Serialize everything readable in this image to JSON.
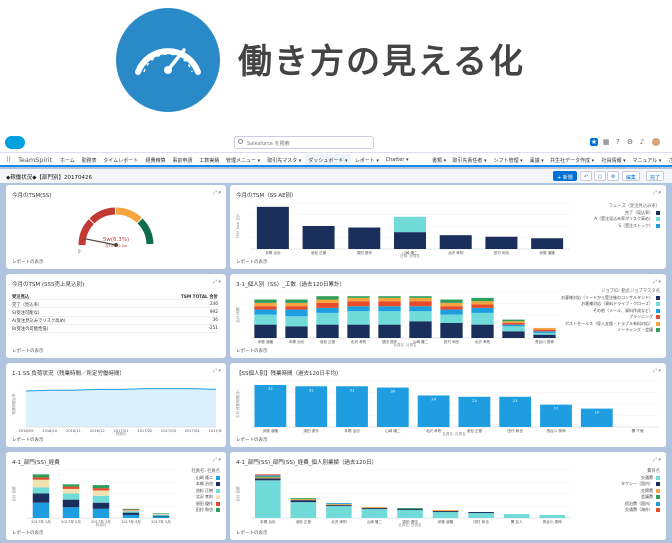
{
  "hero": {
    "title": "働き方の見える化"
  },
  "colors": {
    "navy": "#1b2f5c",
    "teal": "#70dbd9",
    "blue": "#1e9ee0",
    "hero": "#2a8ac7",
    "red": "#c23934",
    "orange": "#f5a43f",
    "green": "#0d6d4b"
  },
  "topbar": {
    "search_placeholder": "Salesforce を検索"
  },
  "nav": {
    "app_name": "TeamSpirit",
    "items": [
      "ホーム",
      "勤務表",
      "タイムレポート",
      "経費精算",
      "事前申請",
      "工数実績",
      "管理メニュー",
      "取引先マスタ",
      "ダッシュボード",
      "レポート",
      "Chatter",
      "書類",
      "取引先責任者",
      "シフト管理",
      "稟議",
      "共生社データ作成",
      "社員情報",
      "マニュアル",
      "さらに表示"
    ],
    "active": "ダッシュボード"
  },
  "dashboard": {
    "title": "◆稼働状況◆【部門別】20170426",
    "buttons": {
      "new": "+ 新規",
      "undo": "↶",
      "refresh": "○",
      "settings": "⚙",
      "edit": "編集",
      "done": "完了"
    }
  },
  "footer_label": "レポートの表示",
  "cards": {
    "c1": {
      "title": "今月のTSM(SS)",
      "value": "5w(6.3%)",
      "sub": "@1w 1-0-2w"
    },
    "c2": {
      "title": "今月のTSM（SS AE別）",
      "ylabel": "TSM Total 合計",
      "xlabel": "社員: 社員名"
    },
    "c3": {
      "title": "今月のTSM (SSS売上見込別)"
    },
    "c4": {
      "title": "3-1_個人別（SS）_工数（過去120日累計）",
      "ylabel": "合計 時間",
      "xlabel": "社員名: 社員名"
    },
    "c5": {
      "title": "1-1 SS 負荷状況（残業時間／所定労働時間）",
      "ylabel": "残業時間比率",
      "xlabel": "勤務月"
    },
    "c6": {
      "title": "【SS個人別】残業時間（過去120日平均）",
      "ylabel": "平均 残業時間(分)",
      "xlabel": "社員名: 社員名"
    },
    "c7": {
      "title": "4-1_部門(SS)_経費",
      "ylabel": "合計 金額",
      "xlabel": "利用月",
      "legend_title": "社員名: 社員名"
    },
    "c8": {
      "title": "4-1_部門(SS)_部門(SS)_経費_個人別業績（過去120日）",
      "ylabel": "合計 金額",
      "xlabel": "社員名: 社員名",
      "legend_title": "費目名"
    }
  },
  "chart_data": [
    {
      "type": "gauge",
      "id": "c1",
      "value": 6.3,
      "range": [
        0,
        100
      ],
      "tick_labels": [
        "0",
        "",
        "",
        "",
        ""
      ],
      "bands": [
        "#c23934",
        "#c23934",
        "#f5a43f",
        "#0d6d4b"
      ]
    },
    {
      "type": "bar",
      "id": "c2",
      "categories": [
        "本郷 治也",
        "池松 正樹",
        "須田 優作",
        "山崎 隆二",
        "北沢 孝則",
        "田村 和也",
        "伊藤 道隆"
      ],
      "series": [
        {
          "name": "完了（見込率）",
          "values": [
            55,
            30,
            28,
            22,
            18,
            16,
            14
          ],
          "color": "#1b2f5c"
        },
        {
          "name": "A（受注見込み率がリスク高め）",
          "values": [
            0,
            0,
            0,
            20,
            0,
            0,
            0
          ],
          "color": "#70dbd9"
        },
        {
          "name": "S（受注ストック）",
          "values": [
            0,
            0,
            0,
            0,
            0,
            0,
            0
          ],
          "color": "#1e9ee0"
        }
      ],
      "ylim": [
        0,
        60
      ],
      "legend_title": "フェーズ（受注見込み率）",
      "legend_position": "right"
    },
    {
      "type": "table",
      "id": "c3",
      "headers": [
        "受注見込",
        "TSM TOTAL 合計"
      ],
      "rows": [
        [
          "完了（見込率）",
          "246"
        ],
        [
          "S(受注可能な)",
          "992"
        ],
        [
          "A(受注見込みでリスク高め)",
          "36"
        ],
        [
          "B(受注の可能性低)",
          "-251"
        ]
      ]
    },
    {
      "type": "bar",
      "id": "c4",
      "stacked": true,
      "categories": [
        "伊藤 道隆",
        "本郷 治也",
        "池松 正樹",
        "北沢 孝則",
        "須田 優作",
        "山崎 隆二",
        "田村 和也",
        "北沢 孝則",
        "",
        "長谷川 泰伸"
      ],
      "series": [
        {
          "name": "お客様対応（リードから受注後のコンサルタンド）",
          "values": [
            8,
            7,
            8,
            8,
            8,
            10,
            9,
            8,
            4,
            2
          ],
          "color": "#1b2f5c"
        },
        {
          "name": "お客様対応（資料ドライブ・クローズ）",
          "values": [
            6,
            6,
            7,
            8,
            8,
            6,
            5,
            7,
            3,
            1
          ],
          "color": "#70dbd9"
        },
        {
          "name": "その他（メール、資料作成など）",
          "values": [
            3,
            4,
            3,
            3,
            3,
            3,
            3,
            3,
            1,
            1
          ],
          "color": "#1e9ee0"
        },
        {
          "name": "プランニング",
          "values": [
            2,
            2,
            3,
            3,
            3,
            3,
            2,
            2,
            1,
            1
          ],
          "color": "#e84b2b"
        },
        {
          "name": "ポストセールス（導入支援・トラブル有料対応）",
          "values": [
            2,
            2,
            2,
            2,
            2,
            2,
            2,
            2,
            1,
            1
          ],
          "color": "#f5a43f"
        },
        {
          "name": "ミーティング・会議",
          "values": [
            2,
            2,
            2,
            1,
            1,
            1,
            2,
            2,
            1,
            0
          ],
          "color": "#2e9e5b"
        }
      ],
      "legend_title": "ジョブID: 勤怠ジョブマスタ名",
      "legend_position": "right"
    },
    {
      "type": "area",
      "id": "c5",
      "x": [
        "2016/09",
        "2016/10",
        "2016/11",
        "2016/12",
        "2017/01",
        "2017/02",
        "2017/03",
        "2017/04",
        "2017/05"
      ],
      "values": [
        47,
        48,
        48,
        49,
        49,
        50,
        50,
        50,
        49
      ],
      "ylim": [
        0,
        60
      ],
      "color": "#1e9ee0"
    },
    {
      "type": "bar",
      "id": "c6",
      "categories": [
        "伊藤 道隆",
        "須田 優作",
        "本郷 治也",
        "山崎 隆二",
        "北沢 孝則",
        "池松 正樹",
        "田村 和也",
        "長谷川 泰伸",
        "",
        "関 千雅"
      ],
      "values": [
        32,
        31,
        31,
        30,
        24,
        23,
        23,
        17,
        14,
        0
      ],
      "data_labels": [
        "32",
        "31",
        "31",
        "30",
        "24",
        "23",
        "23",
        "17",
        "14",
        ""
      ],
      "ylim": [
        0,
        35
      ],
      "color": "#1e9ee0"
    },
    {
      "type": "bar",
      "id": "c7",
      "stacked": true,
      "categories": [
        "2017年 1月",
        "2017年 2月",
        "2017年 3月",
        "2017年 4月",
        "2017年 5月"
      ],
      "series": [
        {
          "name": "山崎 隆二",
          "values": [
            20,
            14,
            12,
            4,
            2
          ],
          "color": "#1e9ee0"
        },
        {
          "name": "本郷 治也",
          "values": [
            12,
            10,
            8,
            3,
            1
          ],
          "color": "#1b2f5c"
        },
        {
          "name": "池松 正樹",
          "values": [
            8,
            8,
            9,
            2,
            1
          ],
          "color": "#70dbd9"
        },
        {
          "name": "北沢 孝則",
          "values": [
            10,
            6,
            7,
            1,
            1
          ],
          "color": "#f0e3b0"
        },
        {
          "name": "須田 優作",
          "values": [
            3,
            3,
            3,
            1,
            0
          ],
          "color": "#e84b2b"
        },
        {
          "name": "田村 和也",
          "values": [
            4,
            3,
            4,
            1,
            1
          ],
          "color": "#2e9e5b"
        }
      ],
      "legend_position": "right"
    },
    {
      "type": "bar",
      "id": "c8",
      "stacked": true,
      "categories": [
        "本郷 治也",
        "池松 正樹",
        "北沢 孝則",
        "山崎 隆二",
        "須田 優作",
        "伊藤 道隆",
        "田村 和也",
        "関 友人",
        "長谷川 泰伸"
      ],
      "series": [
        {
          "name": "交通費",
          "values": [
            38,
            16,
            12,
            9,
            8,
            6,
            5,
            4,
            3
          ],
          "color": "#70dbd9"
        },
        {
          "name": "タクシー（国内）",
          "values": [
            2,
            2,
            1,
            1,
            1,
            1,
            1,
            0,
            0
          ],
          "color": "#1b2f5c"
        },
        {
          "name": "交際費",
          "values": [
            1,
            1,
            1,
            1,
            0,
            1,
            0,
            0,
            0
          ],
          "color": "#f5a43f"
        },
        {
          "name": "会議費",
          "values": [
            1,
            1,
            0,
            0,
            1,
            0,
            0,
            0,
            0
          ],
          "color": "#2e9e5b"
        },
        {
          "name": "宿泊費（国内）",
          "values": [
            1,
            0,
            1,
            0,
            0,
            0,
            0,
            0,
            0
          ],
          "color": "#1e9ee0"
        },
        {
          "name": "交通費（海外）",
          "values": [
            1,
            0,
            0,
            0,
            0,
            0,
            0,
            0,
            0
          ],
          "color": "#e84b2b"
        }
      ],
      "legend_position": "right"
    }
  ]
}
